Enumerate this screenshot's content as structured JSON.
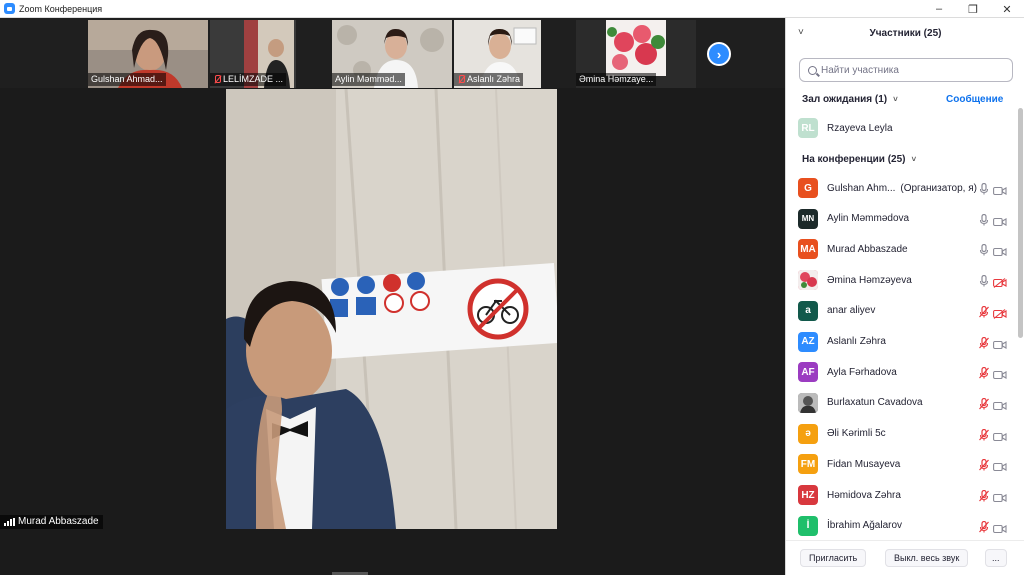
{
  "window": {
    "title": "Zoom Конференция",
    "controls": [
      "–",
      "❐",
      "✕"
    ]
  },
  "thumbnails": [
    {
      "name": "Gulshan Ahmad...",
      "muted": false
    },
    {
      "name": "LELİMZADE ...",
      "muted": true
    },
    {
      "name": "Aylin  Məmməd...",
      "muted": false
    },
    {
      "name": "Aslanlı Zəhra",
      "muted": true
    },
    {
      "name": "Əmina Həmzaye...",
      "muted": false
    }
  ],
  "next_button": "›",
  "active_speaker": {
    "name": "Murad Abbaszade"
  },
  "panel": {
    "title": "Участники (25)",
    "collapse_icon": "˅",
    "search_placeholder": "Найти участника",
    "waiting_room": {
      "label": "Зал ожидания (1)",
      "message_link": "Сообщение"
    },
    "in_meeting_label": "На конференции (25)",
    "waiting": [
      {
        "initials": "RL",
        "name": "Rzayeva Leyla",
        "color": "#bfe0cf"
      }
    ],
    "participants": [
      {
        "initials": "G",
        "name": "Gulshan Ahm...",
        "role": "(Организатор, я)",
        "color": "#e8501f",
        "mic_muted": false,
        "video_off": false
      },
      {
        "initials": "MN",
        "name": "Aylin  Məmmədova",
        "role": "",
        "color": "#1c2a2a",
        "mic_muted": false,
        "video_off": false
      },
      {
        "initials": "MA",
        "name": "Murad Abbaszade",
        "role": "",
        "color": "#e8501f",
        "mic_muted": false,
        "video_off": false
      },
      {
        "initials": "",
        "name": "Əmina Həmzəyeva",
        "role": "",
        "color": "#e0455c",
        "mic_muted": false,
        "video_off": true
      },
      {
        "initials": "a",
        "name": "anar aliyev",
        "role": "",
        "color": "#12594b",
        "mic_muted": true,
        "video_off": true
      },
      {
        "initials": "AZ",
        "name": "Aslanlı Zəhra",
        "role": "",
        "color": "#2d8cff",
        "mic_muted": true,
        "video_off": false
      },
      {
        "initials": "AF",
        "name": "Ayla Fərhadova",
        "role": "",
        "color": "#9b3cc1",
        "mic_muted": true,
        "video_off": false
      },
      {
        "initials": "",
        "name": "Burlaxatun Cavadova",
        "role": "",
        "color": "#6c6c6c",
        "mic_muted": true,
        "video_off": false
      },
      {
        "initials": "ə",
        "name": "Əli Kərimli 5c",
        "role": "",
        "color": "#f5a010",
        "mic_muted": true,
        "video_off": false
      },
      {
        "initials": "FM",
        "name": "Fidan Musayeva",
        "role": "",
        "color": "#f5a010",
        "mic_muted": true,
        "video_off": false
      },
      {
        "initials": "HZ",
        "name": "Həmidova Zəhra",
        "role": "",
        "color": "#d8383e",
        "mic_muted": true,
        "video_off": false
      },
      {
        "initials": "İ",
        "name": "İbrahim Ağalarov",
        "role": "",
        "color": "#1fbf6b",
        "mic_muted": true,
        "video_off": false
      }
    ],
    "footer": {
      "invite": "Пригласить",
      "mute_all": "Выкл. весь звук",
      "more": "..."
    }
  }
}
